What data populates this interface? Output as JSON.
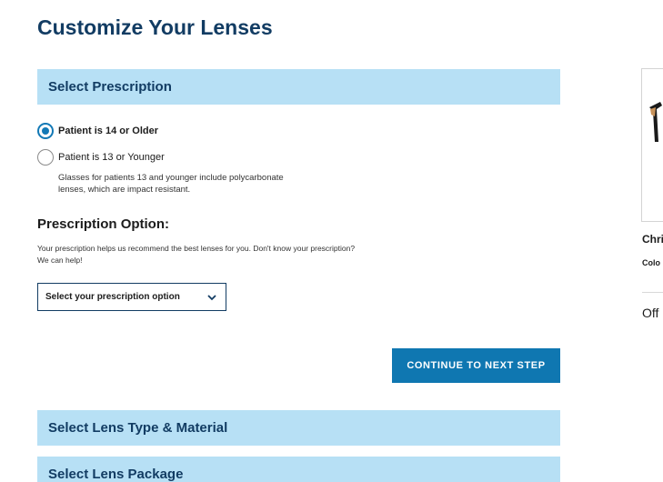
{
  "page": {
    "title": "Customize Your Lenses"
  },
  "sections": {
    "prescription": "Select Prescription",
    "lens_type": "Select Lens Type & Material",
    "lens_package": "Select Lens Package"
  },
  "patient_age": {
    "options": [
      {
        "label": "Patient is 14 or Older",
        "selected": true
      },
      {
        "label": "Patient is 13 or Younger",
        "selected": false
      }
    ],
    "note": "Glasses for patients 13 and younger include polycarbonate lenses, which are impact resistant."
  },
  "prescription_option": {
    "heading": "Prescription Option:",
    "description": "Your prescription helps us recommend the best lenses for you. Don't know your prescription? We can help!",
    "select_value": "Select your prescription option",
    "icon": "chevron-down-icon"
  },
  "actions": {
    "continue_label": "CONTINUE TO NEXT STEP"
  },
  "product": {
    "name": "Chri",
    "color_label": "Colo",
    "offer_text": "Off"
  },
  "colors": {
    "accent": "#0f77b1",
    "section_bg": "#b7e0f5",
    "title": "#123c63"
  }
}
